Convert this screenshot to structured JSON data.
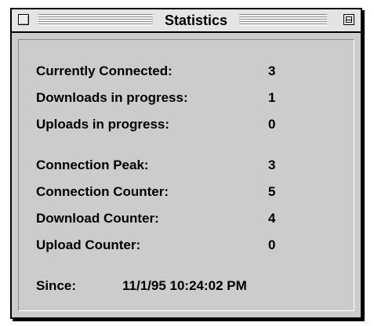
{
  "window": {
    "title": "Statistics"
  },
  "stats": {
    "group1": [
      {
        "label": "Currently Connected:",
        "value": "3"
      },
      {
        "label": "Downloads in progress:",
        "value": "1"
      },
      {
        "label": "Uploads in progress:",
        "value": "0"
      }
    ],
    "group2": [
      {
        "label": "Connection Peak:",
        "value": "3"
      },
      {
        "label": "Connection Counter:",
        "value": "5"
      },
      {
        "label": "Download Counter:",
        "value": "4"
      },
      {
        "label": "Upload Counter:",
        "value": "0"
      }
    ],
    "since": {
      "label": "Since:",
      "value": "11/1/95 10:24:02 PM"
    }
  },
  "icons": {
    "close": "close-box-icon",
    "zoom": "zoom-box-icon"
  }
}
